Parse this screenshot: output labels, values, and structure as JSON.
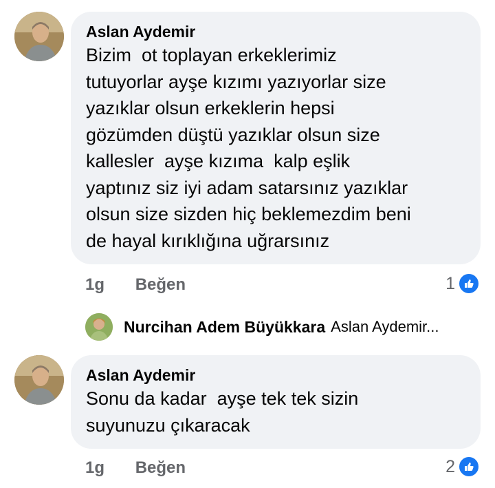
{
  "comments": [
    {
      "author": "Aslan Aydemir",
      "text": "Bizim  ot toplayan erkeklerimiz\ntutuyorlar ayşe kızımı yazıyorlar size\nyazıklar olsun erkeklerin hepsi\ngözümden düştü yazıklar olsun size\nkallesler  ayşe kızıma  kalp eşlik\nyaptınız siz iyi adam satarsınız yazıklar\nolsun size sizden hiç beklemezdim beni\nde hayal kırıklığına uğrarsınız",
      "time": "1g",
      "like_label": "Beğen",
      "reaction_count": "1"
    },
    {
      "author": "Aslan Aydemir",
      "text": "Sonu da kadar  ayşe tek tek sizin\nsuyunuzu çıkaracak",
      "time": "1g",
      "like_label": "Beğen",
      "reaction_count": "2"
    }
  ],
  "reply_preview": {
    "author": "Nurcihan Adem Büyükkara",
    "snippet": "Aslan Aydemir..."
  },
  "colors": {
    "bubble": "#f0f2f5",
    "muted": "#65676b",
    "like_blue": "#1877f2"
  },
  "icons": {
    "reaction": "like-thumb-icon"
  }
}
